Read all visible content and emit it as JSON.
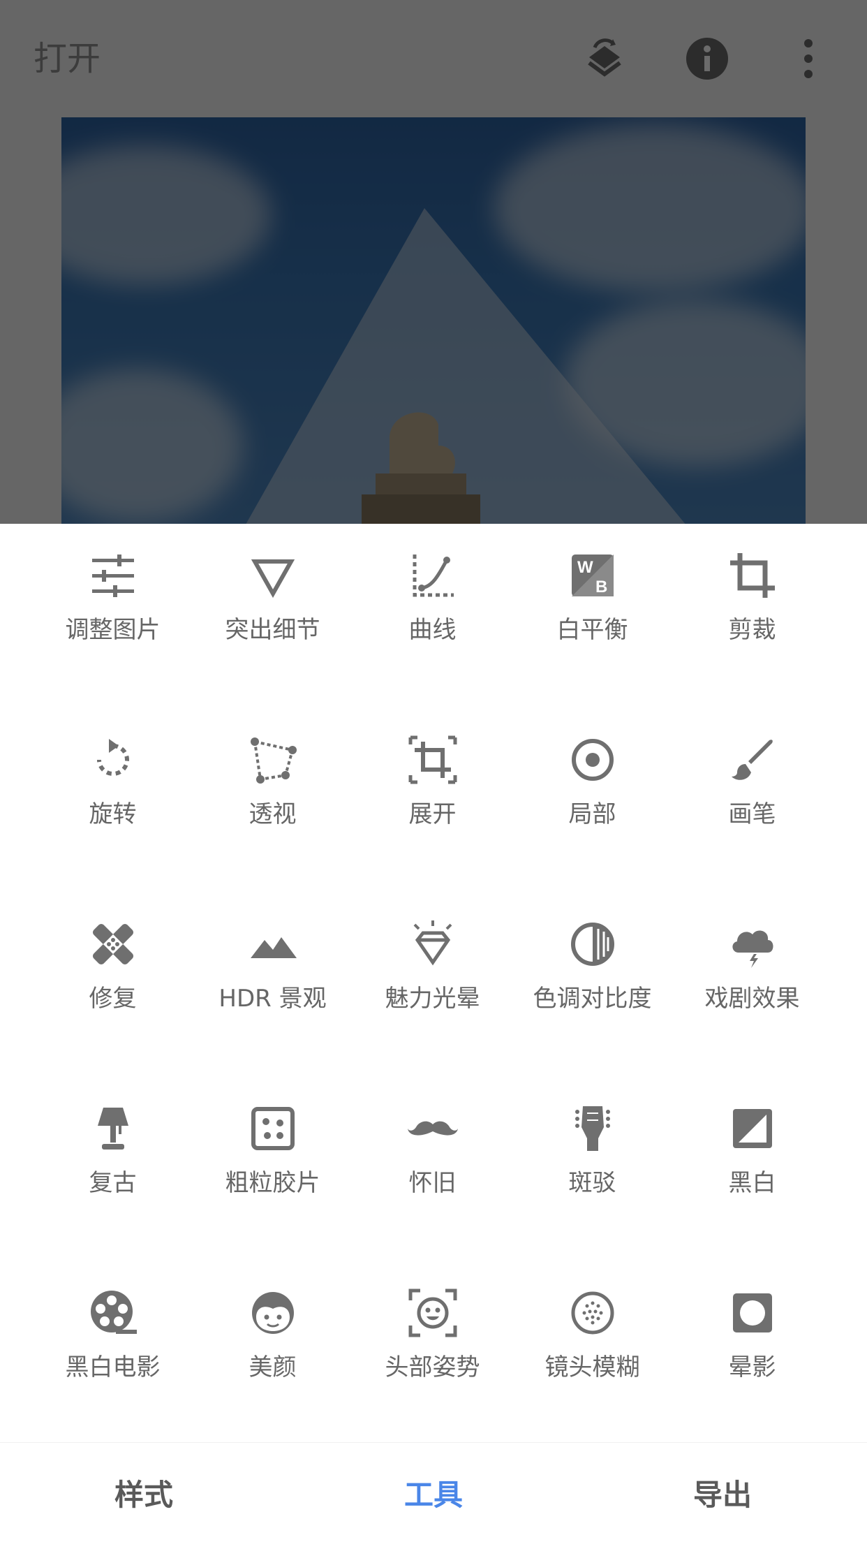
{
  "appbar": {
    "title": "打开",
    "actions": [
      {
        "name": "layers-icon"
      },
      {
        "name": "info-icon"
      },
      {
        "name": "more-vert-icon"
      }
    ]
  },
  "tools": [
    {
      "label": "调整图片",
      "icon": "tune-icon"
    },
    {
      "label": "突出细节",
      "icon": "details-icon"
    },
    {
      "label": "曲线",
      "icon": "curves-icon"
    },
    {
      "label": "白平衡",
      "icon": "white-balance-icon"
    },
    {
      "label": "剪裁",
      "icon": "crop-icon"
    },
    {
      "label": "旋转",
      "icon": "rotate-icon"
    },
    {
      "label": "透视",
      "icon": "perspective-icon"
    },
    {
      "label": "展开",
      "icon": "expand-icon"
    },
    {
      "label": "局部",
      "icon": "selective-icon"
    },
    {
      "label": "画笔",
      "icon": "brush-icon"
    },
    {
      "label": "修复",
      "icon": "healing-icon"
    },
    {
      "label": "HDR 景观",
      "icon": "hdr-landscape-icon"
    },
    {
      "label": "魅力光晕",
      "icon": "glamour-glow-icon"
    },
    {
      "label": "色调对比度",
      "icon": "tonal-contrast-icon"
    },
    {
      "label": "戏剧效果",
      "icon": "drama-icon"
    },
    {
      "label": "复古",
      "icon": "vintage-lamp-icon"
    },
    {
      "label": "粗粒胶片",
      "icon": "grainy-film-icon"
    },
    {
      "label": "怀旧",
      "icon": "retrolux-mustache-icon"
    },
    {
      "label": "斑驳",
      "icon": "grunge-guitar-icon"
    },
    {
      "label": "黑白",
      "icon": "black-white-icon"
    },
    {
      "label": "黑白电影",
      "icon": "noir-film-reel-icon"
    },
    {
      "label": "美颜",
      "icon": "portrait-face-icon"
    },
    {
      "label": "头部姿势",
      "icon": "head-pose-icon"
    },
    {
      "label": "镜头模糊",
      "icon": "lens-blur-icon"
    },
    {
      "label": "晕影",
      "icon": "vignette-icon"
    }
  ],
  "bottom_nav": {
    "tabs": [
      {
        "label": "样式",
        "active": false
      },
      {
        "label": "工具",
        "active": true
      },
      {
        "label": "导出",
        "active": false
      }
    ],
    "active_color": "#4a86e8"
  },
  "colors": {
    "icon": "#6f6f6f",
    "label": "#666666"
  }
}
